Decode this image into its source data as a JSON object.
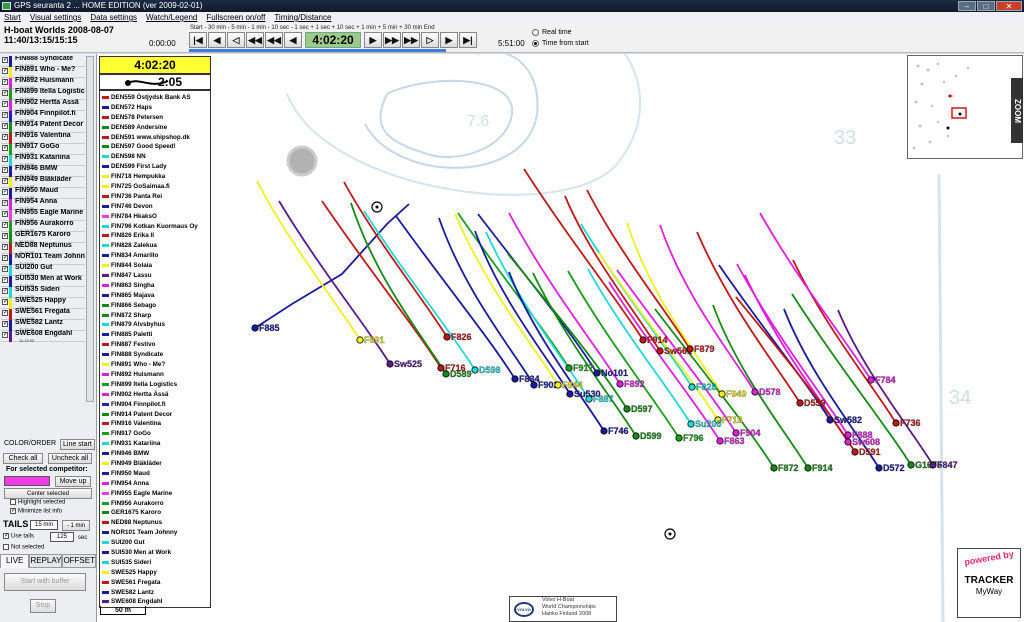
{
  "window": {
    "title": "GPS seuranta 2 ... HOME EDITION  (ver 2009-02-01)"
  },
  "menu": [
    "Start",
    "Visual settings",
    "Data settings",
    "Watch/Legend",
    "Fullscreen on/off",
    "Timing/Distance"
  ],
  "race": {
    "title": "H-boat Worlds 2008-08-07",
    "times": "11:40/13:15/15:15"
  },
  "player": {
    "start_time": "0:00:00",
    "current_time": "4:02:20",
    "end_time": "5:51:00",
    "step_labels": "Start    - 30 min - 5 min  - 1 min  - 10 sec  - 1 sec                          + 1 sec  + 10 sec + 1 min  + 5 min  + 30 min End",
    "progress_fraction": 0.69,
    "modes": [
      "Real time",
      "Time from start"
    ],
    "selected_mode": "Time from start"
  },
  "competitors": [
    {
      "name": "FIN888 Syndicate",
      "color": "#1a1aa0",
      "time": "11:15:00"
    },
    {
      "name": "FIN891 Who - Me?",
      "color": "#f0f020",
      "time": "11:15:00"
    },
    {
      "name": "FIN892 Huismann",
      "color": "#e01ee0",
      "time": "11:15:00"
    },
    {
      "name": "FIN899 Itella Logistics",
      "color": "#18a018",
      "time": "11:15:00"
    },
    {
      "name": "FIN902 Hertta Ässä",
      "color": "#e01ee0",
      "time": "11:15:00"
    },
    {
      "name": "FIN904 Finnpilot.fi",
      "color": "#2020c0",
      "time": "11:15:00"
    },
    {
      "name": "FIN914 Patent Decor",
      "color": "#148a14",
      "time": "11:15:00"
    },
    {
      "name": "FIN916 Valentina",
      "color": "#c01818",
      "time": "11:15:00"
    },
    {
      "name": "FIN917 GoGo",
      "color": "#18a018",
      "time": "11:15:00"
    },
    {
      "name": "FIN931 Katariina",
      "color": "#20d8d8",
      "time": "11:15:00"
    },
    {
      "name": "FIN946 BMW",
      "color": "#1a1aa0",
      "time": "11:15:00"
    },
    {
      "name": "FIN949 Bläkläder",
      "color": "#f0f020",
      "time": "11:15:00"
    },
    {
      "name": "FIN950 Maud",
      "color": "#1a1aa0",
      "time": "11:15:00"
    },
    {
      "name": "FIN954 Anna",
      "color": "#e01ee0",
      "time": "11:15:00"
    },
    {
      "name": "FIN955 Eagle Marine",
      "color": "#f03ce6",
      "time": "11:15:00"
    },
    {
      "name": "FIN956 Aurakorro",
      "color": "#18a018",
      "time": "11:15:00"
    },
    {
      "name": "GER1675 Karoro",
      "color": "#148a14",
      "time": "11:15:00"
    },
    {
      "name": "NED88 Neptunus",
      "color": "#c01818",
      "time": "11:15:00"
    },
    {
      "name": "NOR101 Team Johnny",
      "color": "#1a1aa0",
      "time": "11:15:00"
    },
    {
      "name": "SUI200 Gut",
      "color": "#20d8d8",
      "time": "11:15:00"
    },
    {
      "name": "SUI530 Men at Work",
      "color": "#1a1aa0",
      "time": "11:15:00"
    },
    {
      "name": "SUI535 Sideri",
      "color": "#20d8d8",
      "time": "11:15:00"
    },
    {
      "name": "SWE525 Happy",
      "color": "#f0f020",
      "time": "11:15:00"
    },
    {
      "name": "SWE561 Fregata",
      "color": "#c01818",
      "time": "11:15:00"
    },
    {
      "name": "SWE582 Lantz",
      "color": "#1a1aa0",
      "time": "11:15:00"
    },
    {
      "name": "SWE608 Engdahl",
      "color": "#5a1a8a",
      "time": "11:15:00"
    }
  ],
  "left_controls": {
    "tab_color": "COLOR/ORDER",
    "tab_line": "Line start",
    "check_all": "Check all",
    "uncheck_all": "Uncheck all",
    "for_selected": "For selected competitor:",
    "move_up": "Move up",
    "center_selected": "Center selected",
    "highlight_selected": "Highlight selected",
    "minimize_list": "Minimize list info",
    "tails_label": "TAILS",
    "tails_minutes": "15 min",
    "tails_minus": "- 1 min",
    "use_tails": "Use tails",
    "not_selected": "Not selected",
    "tails_seconds": "125",
    "sec_label": "sec",
    "tabs": [
      "LIVE",
      "REPLAY",
      "OFFSET"
    ],
    "start_with_buffer": "Start with buffer",
    "stop": "Stop"
  },
  "map": {
    "clock": "4:02:20",
    "wind_value": "2:05",
    "scale": "50 m",
    "zoom_label": "ZOOM",
    "sponsor_line1": "Volvo H-Boat",
    "sponsor_line2": "World Championships",
    "sponsor_line3": "Hanko Finland 2008",
    "powered_by": "powered by",
    "tracker": "TRACKER",
    "myway": "MyWay"
  },
  "boat_list": [
    {
      "name": "DEN559 Östjydsk Bank AS",
      "color": "#c01818"
    },
    {
      "name": "DEN572 Haps",
      "color": "#1a1aa0"
    },
    {
      "name": "DEN578 Petersen",
      "color": "#c01818"
    },
    {
      "name": "DEN589 Andersine",
      "color": "#148a14"
    },
    {
      "name": "DEN591 www.shipshop.dk",
      "color": "#c01818"
    },
    {
      "name": "DEN597 Good Speed!",
      "color": "#148a14"
    },
    {
      "name": "DEN598 NN",
      "color": "#20d8d8"
    },
    {
      "name": "DEN599 First Lady",
      "color": "#1a1aa0"
    },
    {
      "name": "FIN718 Hempukka",
      "color": "#f0f020"
    },
    {
      "name": "FIN725 GoSaimaa.fi",
      "color": "#f0f020"
    },
    {
      "name": "FIN736 Panta Rei",
      "color": "#c01818"
    },
    {
      "name": "FIN746 Devon",
      "color": "#1a1aa0"
    },
    {
      "name": "FIN784 HkaksO",
      "color": "#f03ce6"
    },
    {
      "name": "FIN796 Kotkan Kuormaus Oy",
      "color": "#20d8d8"
    },
    {
      "name": "FIN826 Erika II",
      "color": "#c01818"
    },
    {
      "name": "FIN828 Zalekua",
      "color": "#20d8d8"
    },
    {
      "name": "FIN834 Amarillo",
      "color": "#1a1aa0"
    },
    {
      "name": "FIN844 Solaia",
      "color": "#f0f020"
    },
    {
      "name": "FIN847 Lassu",
      "color": "#5a1a8a"
    },
    {
      "name": "FIN863 Singha",
      "color": "#e01ee0"
    },
    {
      "name": "FIN865 Majava",
      "color": "#1a1aa0"
    },
    {
      "name": "FIN866 Sebago",
      "color": "#148a14"
    },
    {
      "name": "FIN872 Sharp",
      "color": "#148a14"
    },
    {
      "name": "FIN879 Alvsbyhus",
      "color": "#20d8d8"
    },
    {
      "name": "FIN885 Paletti",
      "color": "#1a1aa0"
    },
    {
      "name": "FIN887 Festivo",
      "color": "#c01818"
    },
    {
      "name": "FIN888 Syndicate",
      "color": "#1a1aa0"
    },
    {
      "name": "FIN891 Who - Me?",
      "color": "#f0f020"
    },
    {
      "name": "FIN892 Huismann",
      "color": "#e01ee0"
    },
    {
      "name": "FIN899 Itella Logistics",
      "color": "#18a018"
    },
    {
      "name": "FIN902 Hertta Ässä",
      "color": "#e01ee0"
    },
    {
      "name": "FIN904 Finnpilot.fi",
      "color": "#2020c0"
    },
    {
      "name": "FIN914 Patent Decor",
      "color": "#148a14"
    },
    {
      "name": "FIN916 Valentina",
      "color": "#c01818"
    },
    {
      "name": "FIN917 GoGo",
      "color": "#18a018"
    },
    {
      "name": "FIN931 Katariina",
      "color": "#20d8d8"
    },
    {
      "name": "FIN946 BMW",
      "color": "#1a1aa0"
    },
    {
      "name": "FIN949 Bläkläder",
      "color": "#f0f020"
    },
    {
      "name": "FIN950 Maud",
      "color": "#1a1aa0"
    },
    {
      "name": "FIN954 Anna",
      "color": "#e01ee0"
    },
    {
      "name": "FIN955 Eagle Marine",
      "color": "#f03ce6"
    },
    {
      "name": "FIN956 Aurakorro",
      "color": "#18a018"
    },
    {
      "name": "GER1675 Karoro",
      "color": "#148a14"
    },
    {
      "name": "NED88 Neptunus",
      "color": "#c01818"
    },
    {
      "name": "NOR101 Team Johnny",
      "color": "#1a1aa0"
    },
    {
      "name": "SUI200 Gut",
      "color": "#20d8d8"
    },
    {
      "name": "SUI530 Men at Work",
      "color": "#1a1aa0"
    },
    {
      "name": "SUI535 Sideri",
      "color": "#20d8d8"
    },
    {
      "name": "SWE525 Happy",
      "color": "#f0f020"
    },
    {
      "name": "SWE561 Fregata",
      "color": "#c01818"
    },
    {
      "name": "SWE582 Lantz",
      "color": "#1a1aa0"
    },
    {
      "name": "SWE608 Engdahl",
      "color": "#5a1a8a"
    }
  ],
  "boat_labels": [
    {
      "label": "F885",
      "color": "#1a1aa0"
    },
    {
      "label": "F891",
      "color": "#f0f020"
    },
    {
      "label": "Sw525",
      "color": "#5a1a8a"
    },
    {
      "label": "F716",
      "color": "#c01818"
    },
    {
      "label": "D589",
      "color": "#148a14"
    },
    {
      "label": "F826",
      "color": "#c01818"
    },
    {
      "label": "D598",
      "color": "#20d8d8"
    },
    {
      "label": "F834",
      "color": "#1a1aa0"
    },
    {
      "label": "F902",
      "color": "#1a1aa0"
    },
    {
      "label": "F844",
      "color": "#f0f020"
    },
    {
      "label": "F917",
      "color": "#18a018"
    },
    {
      "label": "No101",
      "color": "#1a1aa0"
    },
    {
      "label": "Su530",
      "color": "#1a1aa0"
    },
    {
      "label": "F887",
      "color": "#20d8d8"
    },
    {
      "label": "F892",
      "color": "#e01ee0"
    },
    {
      "label": "D597",
      "color": "#148a14"
    },
    {
      "label": "F746",
      "color": "#1a1aa0"
    },
    {
      "label": "D599",
      "color": "#148a14"
    },
    {
      "label": "F796",
      "color": "#18a018"
    },
    {
      "label": "F914",
      "color": "#c01818"
    },
    {
      "label": "Sw561",
      "color": "#c01818"
    },
    {
      "label": "F879",
      "color": "#c01818"
    },
    {
      "label": "F828",
      "color": "#20d8d8"
    },
    {
      "label": "F718",
      "color": "#f0f020"
    },
    {
      "label": "F949",
      "color": "#f0f020"
    },
    {
      "label": "Su200",
      "color": "#20d8d8"
    },
    {
      "label": "F863",
      "color": "#e01ee0"
    },
    {
      "label": "F904",
      "color": "#e01ee0"
    },
    {
      "label": "D578",
      "color": "#e01ee0"
    },
    {
      "label": "D559",
      "color": "#c01818"
    },
    {
      "label": "Sw582",
      "color": "#1a1aa0"
    },
    {
      "label": "F872",
      "color": "#148a14"
    },
    {
      "label": "F914",
      "color": "#148a14"
    },
    {
      "label": "Sw608",
      "color": "#e01ee0"
    },
    {
      "label": "F888",
      "color": "#e01ee0"
    },
    {
      "label": "D591",
      "color": "#c01818"
    },
    {
      "label": "D572",
      "color": "#1a1aa0"
    },
    {
      "label": "F736",
      "color": "#c01818"
    },
    {
      "label": "F784",
      "color": "#e01ee0"
    },
    {
      "label": "G1675",
      "color": "#148a14"
    },
    {
      "label": "F847",
      "color": "#5a1a8a"
    }
  ]
}
